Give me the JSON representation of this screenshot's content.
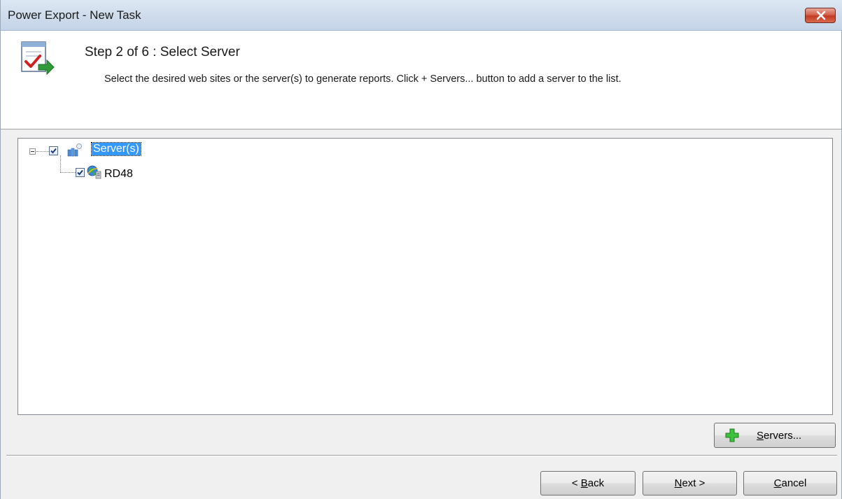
{
  "window": {
    "title": "Power Export - New Task"
  },
  "header": {
    "step_title": "Step 2 of 6 : Select Server",
    "description": "Select the desired web sites or the server(s) to generate reports. Click + Servers... button to add a server to the list."
  },
  "tree": {
    "root": {
      "label": "Server(s)",
      "checked": true,
      "expanded": true,
      "selected": true,
      "icon": "server-group-icon"
    },
    "children": [
      {
        "label": "RD48",
        "checked": true,
        "icon": "web-server-icon"
      }
    ]
  },
  "buttons": {
    "servers": {
      "accel": "S",
      "rest": "ervers...",
      "icon": "plus-icon"
    },
    "back": {
      "prefix": "< ",
      "accel": "B",
      "rest": "ack"
    },
    "next": {
      "accel": "N",
      "rest": "ext >"
    },
    "cancel": {
      "accel": "C",
      "rest": "ancel"
    }
  },
  "colors": {
    "selection": "#3399ff",
    "close_button": "#c23a22",
    "plus_icon": "#2fa82f"
  }
}
